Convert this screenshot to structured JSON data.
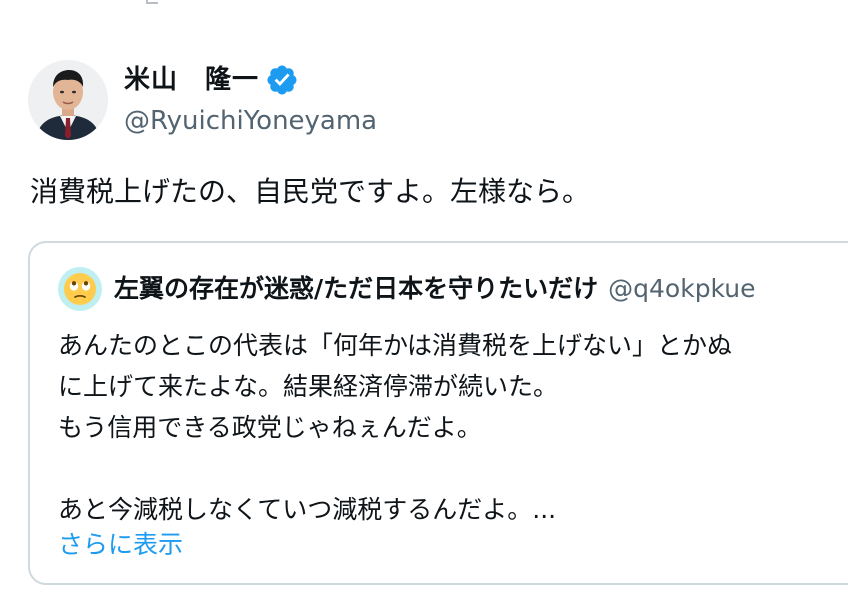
{
  "tweet": {
    "author": {
      "display_name": "米山　隆一",
      "handle": "@RyuichiYoneyama",
      "verified": true,
      "avatar_icon": "person-avatar"
    },
    "text": "消費税上げたの、自民党ですよ。左様なら。",
    "quote": {
      "author": {
        "display_name": "左翼の存在が迷惑/ただ日本を守りたいだけ",
        "handle": "@q4okpkue",
        "avatar_icon": "face-with-rolling-eyes-emoji"
      },
      "lines": [
        "あんたのとこの代表は「何年かは消費税を上げない」とかぬ",
        "に上げて来たよな。結果経済停滞が続いた。",
        "もう信用できる政党じゃねぇんだよ。",
        "",
        "あと今減税しなくていつ減税するんだよ。..."
      ],
      "show_more_label": "さらに表示"
    }
  },
  "colors": {
    "text": "#0f1419",
    "secondary": "#536471",
    "link": "#1d9bf0",
    "verified_badge": "#1d9bf0",
    "border": "#cfd9de"
  }
}
